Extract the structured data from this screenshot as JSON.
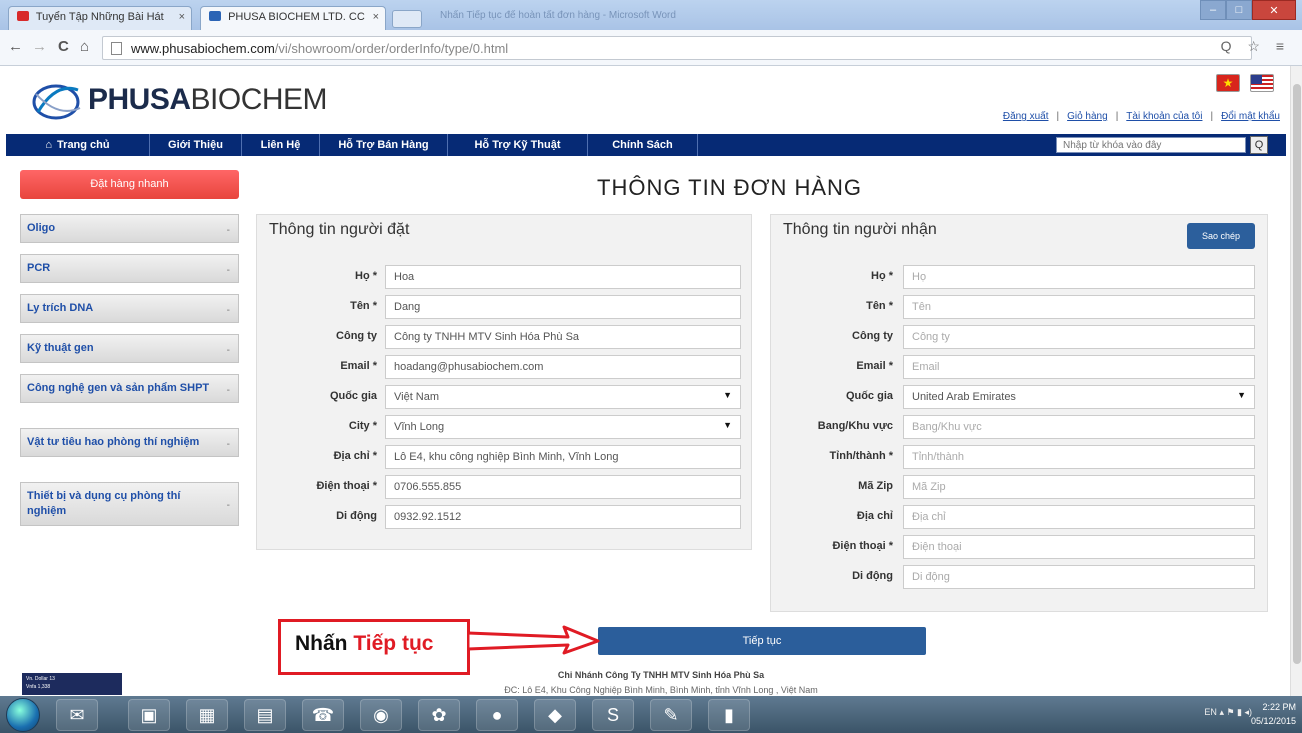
{
  "browser": {
    "tabs": [
      {
        "title": "Tuyển Tập Những Bài Hát",
        "close": "×",
        "favicon_color": "#d82a2a"
      },
      {
        "title": "PHUSA BIOCHEM LTD. CC",
        "close": "×",
        "favicon_color": "#2b64b5"
      }
    ],
    "window_title": "Nhấn Tiếp tục để hoàn tất đơn hàng - Microsoft Word",
    "url_domain": "www.phusabiochem.com",
    "url_path": "/vi/showroom/order/orderInfo/type/0.html",
    "nav_back": "←",
    "nav_forward": "→",
    "nav_reload": "C",
    "nav_home": "⌂",
    "url_icons": "Q ☆ ≡"
  },
  "site": {
    "logo_bold": "PHUSA",
    "logo_light": "BIOCHEM",
    "top_links": [
      "Đăng xuất",
      "Giỏ hàng",
      "Tài khoản của tôi",
      "Đổi mật khẩu"
    ],
    "nav": [
      "Trang chủ",
      "Giới Thiệu",
      "Liên Hệ",
      "Hỗ Trợ Bán Hàng",
      "Hỗ Trợ Kỹ Thuật",
      "Chính Sách"
    ],
    "search_placeholder": "Nhập từ khóa vào đây",
    "search_button": "Q"
  },
  "sidebar": {
    "quick_order": "Đặt hàng nhanh",
    "items": [
      "Oligo",
      "PCR",
      "Ly trích DNA",
      "Kỹ thuật gen",
      "Công nghệ gen và sản phẩm SHPT",
      "Vật tư tiêu hao phòng thí nghiệm",
      "Thiết bị và dụng cụ phòng thí nghiệm"
    ],
    "caret": "-"
  },
  "page_title": "THÔNG TIN ĐƠN HÀNG",
  "orderer": {
    "title": "Thông tin người đặt",
    "fields": [
      {
        "label": "Họ *",
        "value": "Hoa"
      },
      {
        "label": "Tên *",
        "value": "Dang"
      },
      {
        "label": "Công ty",
        "value": "Công ty TNHH MTV Sinh Hóa Phù Sa"
      },
      {
        "label": "Email *",
        "value": "hoadang@phusabiochem.com"
      },
      {
        "label": "Quốc gia",
        "value": "Việt Nam",
        "dropdown": "▼"
      },
      {
        "label": "City *",
        "value": "Vĩnh Long",
        "dropdown": "▼"
      },
      {
        "label": "Địa chỉ *",
        "value": "Lô E4, khu công nghiệp Bình Minh, Vĩnh Long"
      },
      {
        "label": "Điện thoại *",
        "value": "0706.555.855"
      },
      {
        "label": "Di động",
        "value": "0932.92.1512"
      }
    ]
  },
  "recipient": {
    "title": "Thông tin người nhận",
    "copy_button": "Sao chép",
    "fields": [
      {
        "label": "Họ *",
        "placeholder": "Họ"
      },
      {
        "label": "Tên *",
        "placeholder": "Tên"
      },
      {
        "label": "Công ty",
        "placeholder": "Công ty"
      },
      {
        "label": "Email *",
        "placeholder": "Email"
      },
      {
        "label": "Quốc gia",
        "value": "United Arab Emirates",
        "dropdown": "▼"
      },
      {
        "label": "Bang/Khu vực",
        "placeholder": "Bang/Khu vực"
      },
      {
        "label": "Tỉnh/thành *",
        "placeholder": "Tỉnh/thành"
      },
      {
        "label": "Mã Zip",
        "placeholder": "Mã Zip"
      },
      {
        "label": "Địa chỉ",
        "placeholder": "Địa chỉ"
      },
      {
        "label": "Điện thoại *",
        "placeholder": "Điện thoại"
      },
      {
        "label": "Di động",
        "placeholder": "Di động"
      }
    ]
  },
  "next_button": "Tiếp tục",
  "callout": {
    "prefix": "Nhấn ",
    "highlight": "Tiếp tục"
  },
  "footer": {
    "line1": "Chi Nhánh Công Ty TNHH MTV Sinh Hóa Phù Sa",
    "line2": "ĐC: Lô E4, Khu Công Nghiệp Bình Minh, Bình Minh, tỉnh Vĩnh Long , Việt Nam"
  },
  "widget": {
    "line1": "Vn. Dollar   13",
    "line2": "Vnfa   1,338"
  },
  "taskbar": {
    "tray": "EN",
    "time": "2:22 PM",
    "date": "05/12/2015"
  },
  "colors": {
    "nav_bg": "#062a75",
    "quick_order": "#e8453d",
    "accent_button": "#2b5e9b",
    "callout_red": "#e01b24"
  }
}
